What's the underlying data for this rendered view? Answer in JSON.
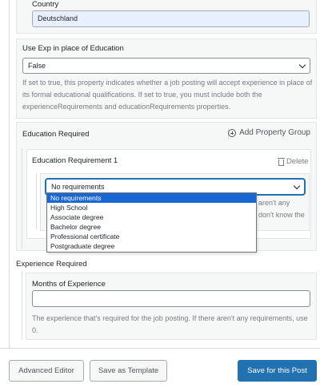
{
  "country": {
    "label": "Country",
    "value": "Deutschland"
  },
  "use_exp": {
    "label": "Use Exp in place of Education",
    "selected": "False",
    "help": "If set to true, this property indicates whether a job posting will accept experience in place of its formal educational qualifications. If set to true, you must include both the experienceRequirements and educationRequirements properties."
  },
  "education": {
    "label": "Education Required",
    "add_group_label": "Add Property Group",
    "group_title": "Education Requirement 1",
    "delete_label": "Delete",
    "selected": "No requirements",
    "hidden_help_line1": "aren't any",
    "hidden_help_line2": "don't know the",
    "options": [
      "No requirements",
      "High School",
      "Associate degree",
      "Bachelor degree",
      "Professional certificate",
      "Postgraduate degree"
    ]
  },
  "experience": {
    "label": "Experience Required",
    "months_label": "Months of Experience",
    "months_value": "",
    "help": "The experience that's required for the job posting. If there aren't any requirements, use 0."
  },
  "footer": {
    "advanced_editor": "Advanced Editor",
    "save_template": "Save as Template",
    "save_post": "Save for this Post"
  },
  "colors": {
    "primary": "#2271b1",
    "selected_option": "#1967d2",
    "autofill": "#e8f0fe"
  }
}
